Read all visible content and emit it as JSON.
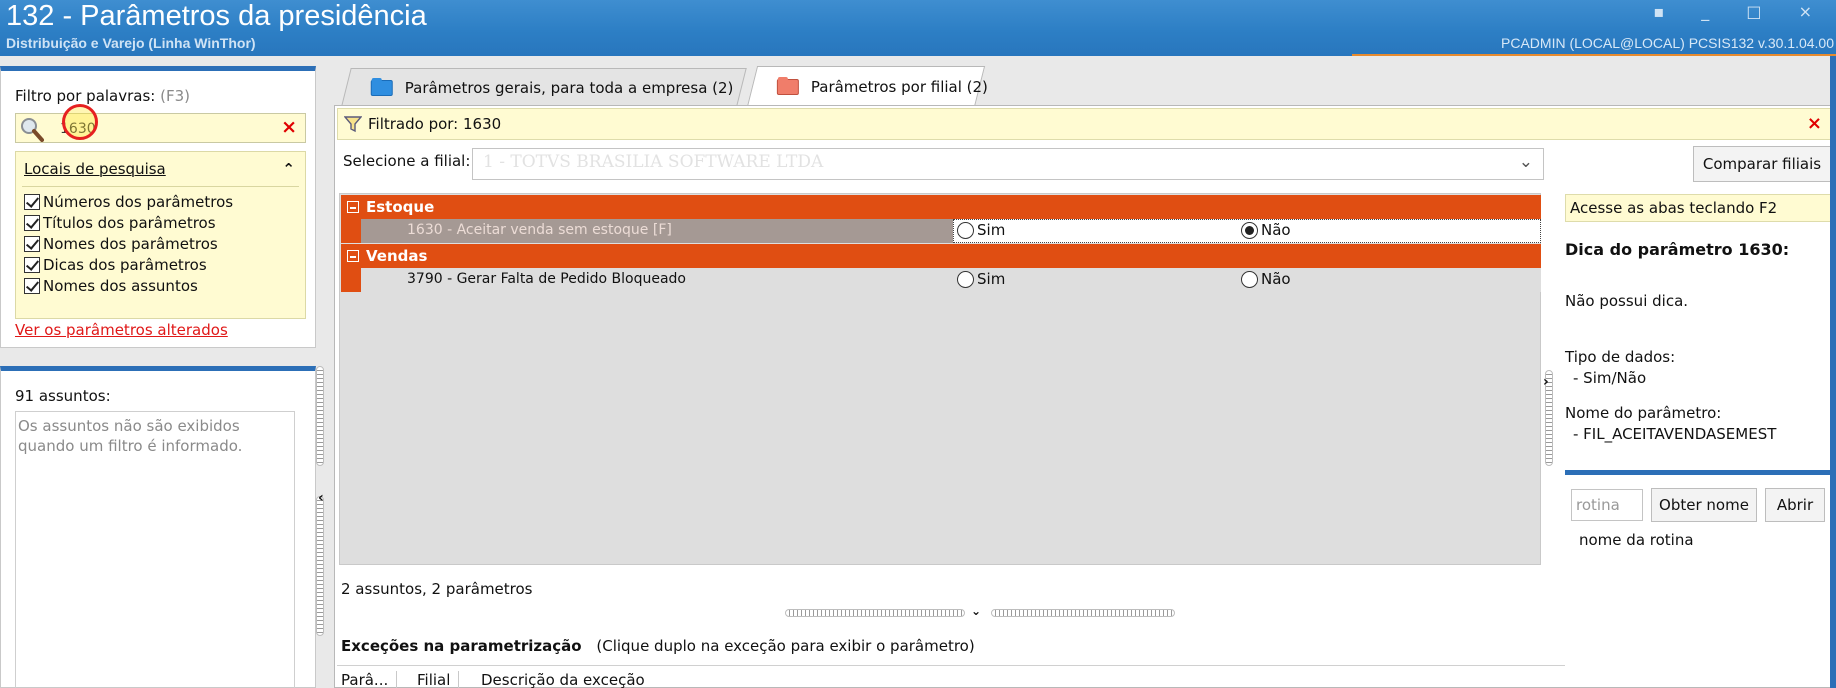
{
  "window": {
    "title": "132 - Parâmetros da presidência",
    "subtitle": "Distribuição e Varejo (Linha WinThor)",
    "user_info": "PCADMIN (LOCAL@LOCAL)   PCSIS132  v.30.1.04.00",
    "controls": "▪ _ □ ×"
  },
  "filter": {
    "label": "Filtro por palavras:",
    "shortcut": "(F3)",
    "search_value": "1630",
    "clear_icon": "×",
    "locais_title": "Locais de pesquisa",
    "collapse_icon": "⌃",
    "options": [
      "Números dos parâmetros",
      "Títulos dos parâmetros",
      "Nomes dos parâmetros",
      "Dicas dos parâmetros",
      "Nomes dos assuntos"
    ],
    "changed_link": "Ver os parâmetros alterados"
  },
  "assuntos": {
    "count_label": "91 assuntos:",
    "message": "Os assuntos não são exibidos quando um filtro é informado."
  },
  "tabs": [
    {
      "label": "Parâmetros gerais, para toda a empresa (2)",
      "icon": "folder-blue-icon",
      "active": false
    },
    {
      "label": "Parâmetros por filial (2)",
      "icon": "folder-red-icon",
      "active": true
    }
  ],
  "main": {
    "filtered_by": "Filtrado por: 1630",
    "close_icon": "×",
    "filial_label": "Selecione a filial:",
    "filial_value": "1 - TOTVS BRASILIA SOFTWARE LTDA",
    "compare_button": "Comparar filiais",
    "groups": [
      {
        "name": "Estoque",
        "param": "1630 - Aceitar venda sem estoque [F]",
        "yes": "Sim",
        "no": "Não",
        "selected": "no"
      },
      {
        "name": "Vendas",
        "param": "3790 - Gerar Falta de Pedido Bloqueado",
        "yes": "Sim",
        "no": "Não",
        "selected": "none"
      }
    ],
    "summary": "2 assuntos, 2 parâmetros",
    "exceptions_title": "Exceções na parametrização",
    "exceptions_hint": "(Clique duplo na exceção para exibir o parâmetro)",
    "exception_columns": [
      "Parâ...",
      "Filial",
      "Descrição da exceção"
    ]
  },
  "side": {
    "hint_bar": "Acesse as abas teclando F2",
    "tip_title": "Dica do parâmetro 1630:",
    "tip_text": "Não possui dica.",
    "data_type_label": "Tipo de dados:",
    "data_type_value": "- Sim/Não",
    "param_name_label": "Nome do parâmetro:",
    "param_name_value": "- FIL_ACEITAVENDASEMEST",
    "routine_placeholder": "rotina",
    "get_name_button": "Obter nome",
    "open_button": "Abrir",
    "routine_name": "nome da rotina"
  },
  "colors": {
    "titlebar": "#2d7fc5",
    "group_header": "#e04e12",
    "highlight_yellow": "#fffbd2",
    "link_red": "#e01818"
  }
}
